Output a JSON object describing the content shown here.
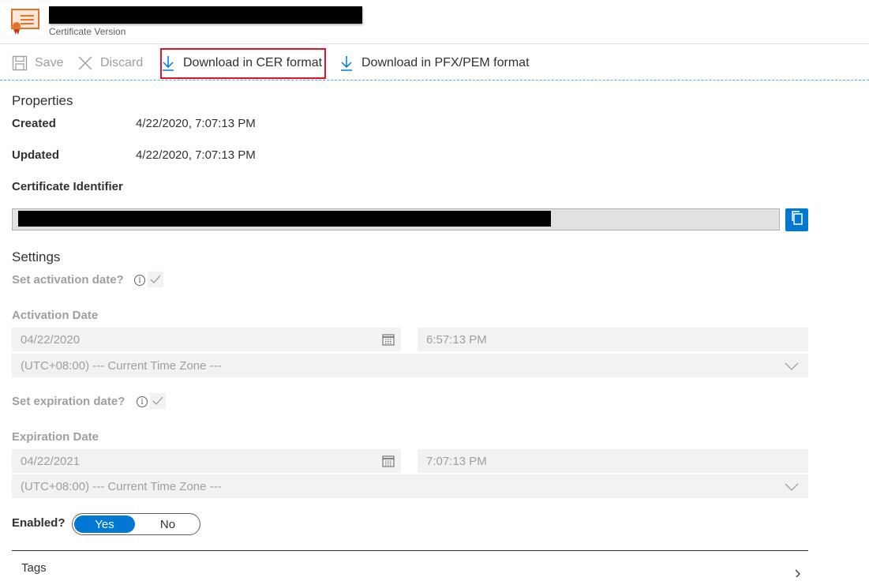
{
  "header": {
    "subtitle": "Certificate Version"
  },
  "toolbar": {
    "save_label": "Save",
    "discard_label": "Discard",
    "download_cer_label": "Download in CER format",
    "download_pfx_label": "Download in PFX/PEM format"
  },
  "properties": {
    "section_title": "Properties",
    "created_label": "Created",
    "created_value": "4/22/2020, 7:07:13 PM",
    "updated_label": "Updated",
    "updated_value": "4/22/2020, 7:07:13 PM",
    "identifier_label": "Certificate Identifier"
  },
  "settings": {
    "section_title": "Settings",
    "set_activation_label": "Set activation date?",
    "activation_date_label": "Activation Date",
    "activation_date_value": "04/22/2020",
    "activation_time_value": "6:57:13 PM",
    "activation_timezone": "(UTC+08:00) --- Current Time Zone ---",
    "set_expiration_label": "Set expiration date?",
    "expiration_date_label": "Expiration Date",
    "expiration_date_value": "04/22/2021",
    "expiration_time_value": "7:07:13 PM",
    "expiration_timezone": "(UTC+08:00) --- Current Time Zone ---",
    "enabled_label": "Enabled?",
    "toggle_yes": "Yes",
    "toggle_no": "No"
  },
  "tags": {
    "label": "Tags"
  },
  "colors": {
    "accent": "#0078d4",
    "highlight": "#e81123",
    "disabled_text": "#a19f9d",
    "icon_orange": "#e8742b"
  }
}
